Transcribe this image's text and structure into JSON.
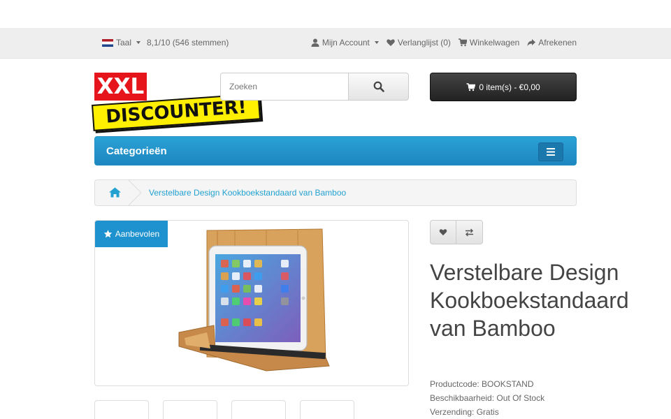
{
  "topbar": {
    "language_label": "Taal",
    "rating": "8,1/10 (546 stemmen)",
    "account": "Mijn Account",
    "wishlist": "Verlanglijst (0)",
    "cart": "Winkelwagen",
    "checkout": "Afrekenen"
  },
  "logo": {
    "line1": "XXL",
    "line2": "DISCOUNTER!"
  },
  "search": {
    "placeholder": "Zoeken"
  },
  "cart_button": {
    "label": "0 item(s) - €0,00"
  },
  "menu": {
    "title": "Categorieën"
  },
  "breadcrumb": {
    "current": "Verstelbare Design Kookboekstandaard van Bamboo"
  },
  "product": {
    "badge": "Aanbevolen",
    "title": "Verstelbare Design Kookboekstandaard van Bamboo",
    "specs": [
      "Productcode: BOOKSTAND",
      "Beschikbaarheid: Out Of Stock",
      "Verzending: Gratis"
    ]
  },
  "colors": {
    "accent": "#1e91cf",
    "brand_red": "#e5151b",
    "brand_yellow": "#ffef00"
  }
}
